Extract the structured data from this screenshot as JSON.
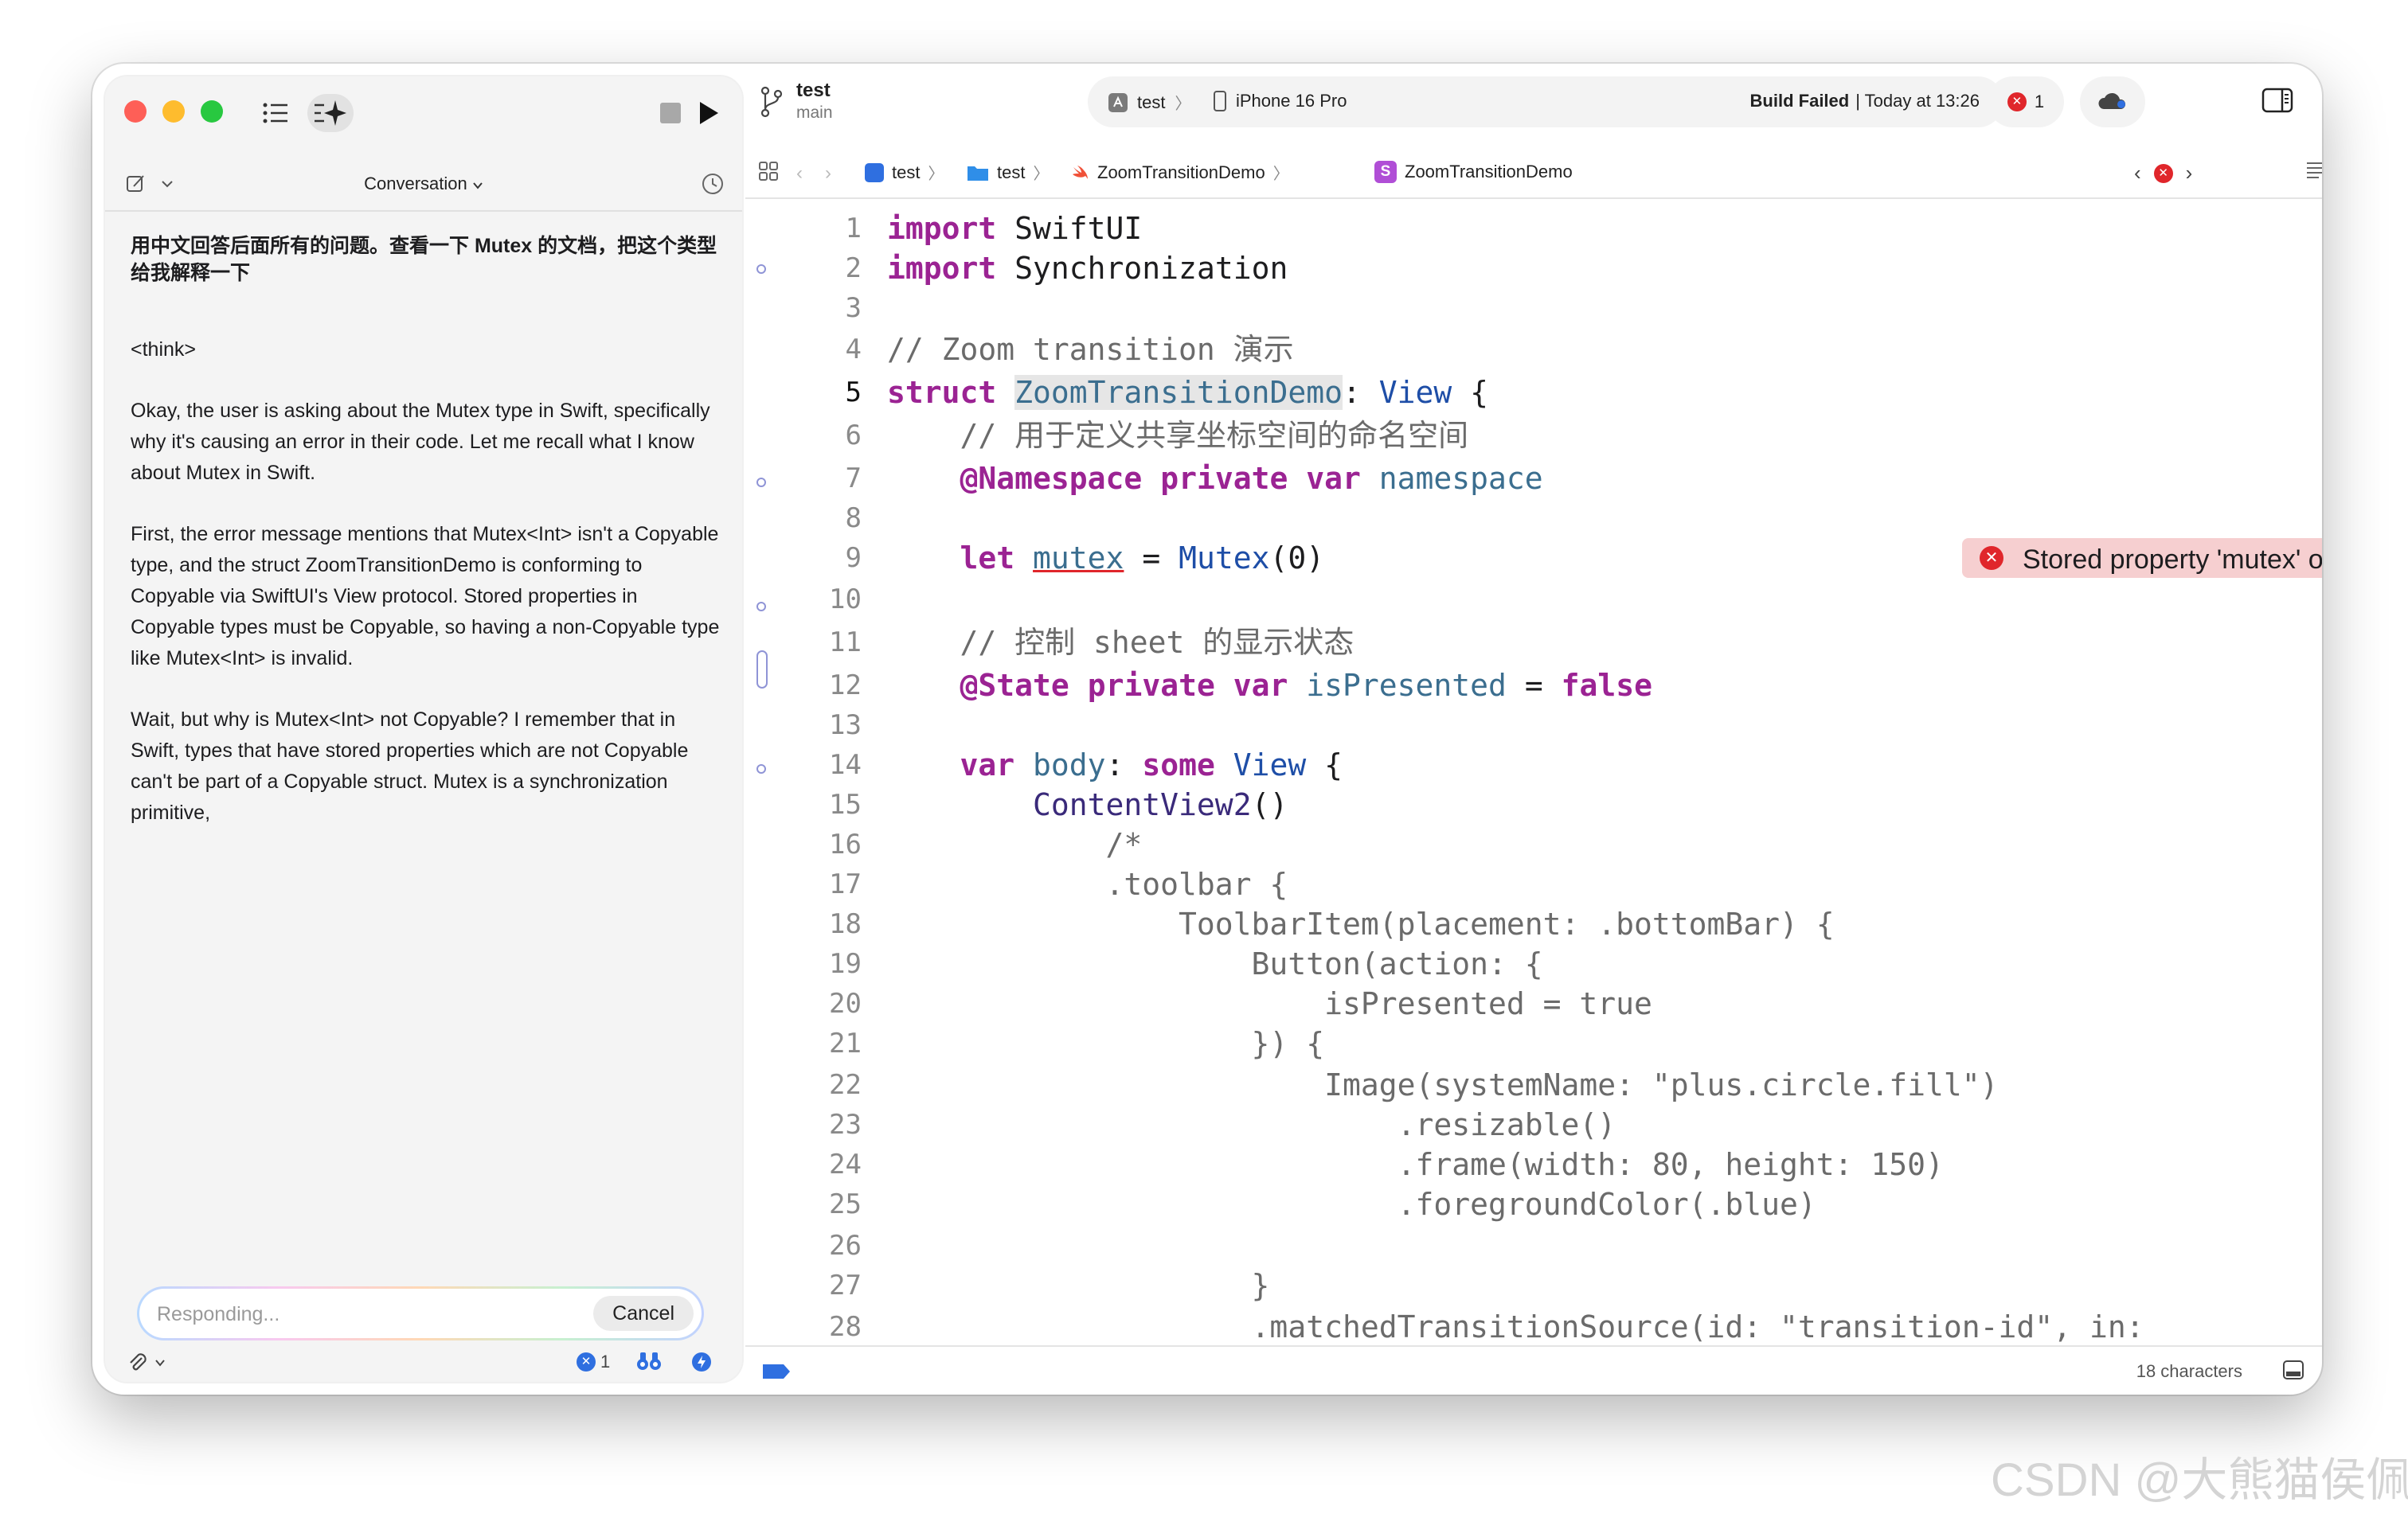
{
  "left_panel": {
    "conversation_label": "Conversation",
    "question": "用中文回答后面所有的问题。查看一下 Mutex 的文档，把这个类型给我解释一下",
    "paragraphs": [
      "<think>",
      "Okay, the user is asking about the Mutex type in Swift, specifically why it's causing an error in their code. Let me recall what I know about Mutex in Swift.",
      "First, the error message mentions that Mutex<Int> isn't a Copyable type, and the struct ZoomTransitionDemo is conforming to Copyable via SwiftUI's View protocol. Stored properties in Copyable types must be Copyable, so having a non-Copyable type like Mutex<Int> is invalid.",
      "Wait, but why is Mutex<Int> not Copyable? I remember that in Swift, types that have stored properties which are not Copyable can't be part of a Copyable struct. Mutex is a synchronization primitive,"
    ],
    "input_placeholder": "Responding...",
    "cancel_label": "Cancel",
    "error_count": "1"
  },
  "toolbar": {
    "project_name": "test",
    "branch": "main",
    "scheme": "test",
    "device": "iPhone 16 Pro",
    "build_status_bold": "Build Failed",
    "build_status_rest": "| Today at 13:26",
    "error_count": "1"
  },
  "jumpbar": {
    "crumbs": [
      "test",
      "test",
      "ZoomTransitionDemo",
      "ZoomTransitionDemo"
    ]
  },
  "editor": {
    "error_message": "Stored property 'mutex' of 'Copyable'-conforming struct 'ZoomTra...",
    "current_line": 5,
    "error_line": 9
  },
  "statusbar": {
    "characters": "18 characters"
  },
  "watermark": "CSDN @大熊猫侯佩",
  "colors": {
    "keyword": "#9b2393",
    "type": "#1e4ea7",
    "error": "#e0262b",
    "error_banner": "#f6cfd0"
  }
}
